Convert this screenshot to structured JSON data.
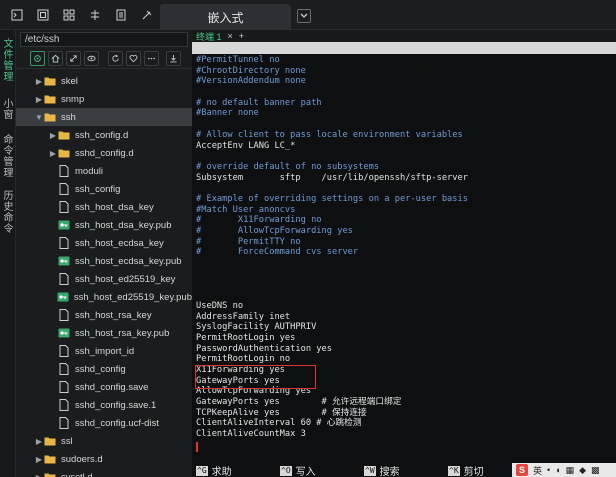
{
  "topbar": {
    "icons": [
      "terminal-icon",
      "window-icon",
      "grid-icon",
      "hierarchy-icon",
      "book-icon",
      "pin-icon"
    ],
    "active_tab": "嵌入式"
  },
  "side_nav": [
    "文件管理",
    "小窗",
    "命令管理",
    "历史命令"
  ],
  "file_panel": {
    "path": "/etc/ssh",
    "tree": [
      {
        "name": "skel",
        "type": "folder",
        "depth": 1,
        "expanded": false
      },
      {
        "name": "snmp",
        "type": "folder",
        "depth": 1,
        "expanded": false
      },
      {
        "name": "ssh",
        "type": "folder",
        "depth": 1,
        "expanded": true,
        "selected": true
      },
      {
        "name": "ssh_config.d",
        "type": "folder",
        "depth": 2,
        "expanded": false
      },
      {
        "name": "sshd_config.d",
        "type": "folder",
        "depth": 2,
        "expanded": false
      },
      {
        "name": "moduli",
        "type": "file",
        "depth": 2
      },
      {
        "name": "ssh_config",
        "type": "file",
        "depth": 2
      },
      {
        "name": "ssh_host_dsa_key",
        "type": "file",
        "depth": 2
      },
      {
        "name": "ssh_host_dsa_key.pub",
        "type": "key",
        "depth": 2
      },
      {
        "name": "ssh_host_ecdsa_key",
        "type": "file",
        "depth": 2
      },
      {
        "name": "ssh_host_ecdsa_key.pub",
        "type": "key",
        "depth": 2
      },
      {
        "name": "ssh_host_ed25519_key",
        "type": "file",
        "depth": 2
      },
      {
        "name": "ssh_host_ed25519_key.pub",
        "type": "key",
        "depth": 2
      },
      {
        "name": "ssh_host_rsa_key",
        "type": "file",
        "depth": 2
      },
      {
        "name": "ssh_host_rsa_key.pub",
        "type": "key",
        "depth": 2
      },
      {
        "name": "ssh_import_id",
        "type": "file",
        "depth": 2
      },
      {
        "name": "sshd_config",
        "type": "file",
        "depth": 2
      },
      {
        "name": "sshd_config.save",
        "type": "file",
        "depth": 2
      },
      {
        "name": "sshd_config.save.1",
        "type": "file",
        "depth": 2
      },
      {
        "name": "sshd_config.ucf-dist",
        "type": "file",
        "depth": 2
      },
      {
        "name": "ssl",
        "type": "folder",
        "depth": 1,
        "expanded": false
      },
      {
        "name": "sudoers.d",
        "type": "folder",
        "depth": 1,
        "expanded": false
      },
      {
        "name": "sysctl.d",
        "type": "folder",
        "depth": 1,
        "expanded": false
      }
    ]
  },
  "terminal": {
    "tab_label": "终端 1",
    "add_tab": "+",
    "nano_title_left": "  GNU nano 4.8",
    "nano_title_center": "sshd_config",
    "lines": [
      {
        "t": "#PermitTunnel no",
        "c": "comment"
      },
      {
        "t": "#ChrootDirectory none",
        "c": "comment"
      },
      {
        "t": "#VersionAddendum none",
        "c": "comment"
      },
      {
        "t": "",
        "c": "text"
      },
      {
        "t": "# no default banner path",
        "c": "comment"
      },
      {
        "t": "#Banner none",
        "c": "comment"
      },
      {
        "t": "",
        "c": "text"
      },
      {
        "t": "# Allow client to pass locale environment variables",
        "c": "comment"
      },
      {
        "t": "AcceptEnv LANG LC_*",
        "c": "text"
      },
      {
        "t": "",
        "c": "text"
      },
      {
        "t": "# override default of no subsystems",
        "c": "comment"
      },
      {
        "t": "Subsystem       sftp    /usr/lib/openssh/sftp-server",
        "c": "text"
      },
      {
        "t": "",
        "c": "text"
      },
      {
        "t": "# Example of overriding settings on a per-user basis",
        "c": "comment"
      },
      {
        "t": "#Match User anoncvs",
        "c": "comment"
      },
      {
        "t": "#       X11Forwarding no",
        "c": "comment"
      },
      {
        "t": "#       AllowTcpForwarding yes",
        "c": "comment"
      },
      {
        "t": "#       PermitTTY no",
        "c": "comment"
      },
      {
        "t": "#       ForceCommand cvs server",
        "c": "comment"
      },
      {
        "t": "",
        "c": "text"
      },
      {
        "t": "",
        "c": "text"
      },
      {
        "t": "",
        "c": "text"
      },
      {
        "t": "",
        "c": "text"
      },
      {
        "t": "UseDNS no",
        "c": "text"
      },
      {
        "t": "AddressFamily inet",
        "c": "text"
      },
      {
        "t": "SyslogFacility AUTHPRIV",
        "c": "text"
      },
      {
        "t": "PermitRootLogin yes",
        "c": "text"
      },
      {
        "t": "PasswordAuthentication yes",
        "c": "text"
      },
      {
        "t": "PermitRootLogin no",
        "c": "text"
      },
      {
        "t": "X11Forwarding yes",
        "c": "text"
      },
      {
        "t": "GatewayPorts yes",
        "c": "text"
      },
      {
        "t": "AllowTcpForwarding yes",
        "c": "text"
      },
      {
        "t": "GatewayPorts yes        # 允许远程端口绑定",
        "c": "text"
      },
      {
        "t": "TCPKeepAlive yes        # 保持连接",
        "c": "text"
      },
      {
        "t": "ClientAliveInterval 60 # 心跳检测",
        "c": "text"
      },
      {
        "t": "ClientAliveCountMax 3",
        "c": "text"
      }
    ],
    "shortcuts": [
      {
        "key": "^G",
        "label": "求助"
      },
      {
        "key": "^O",
        "label": "写入"
      },
      {
        "key": "^W",
        "label": "搜索"
      },
      {
        "key": "^K",
        "label": "剪切"
      }
    ]
  },
  "ime": {
    "logo": "S",
    "label": "英"
  },
  "colors": {
    "accent": "#4cc38a",
    "highlight_box": "#e0352e",
    "comment": "#6f9bd6"
  }
}
